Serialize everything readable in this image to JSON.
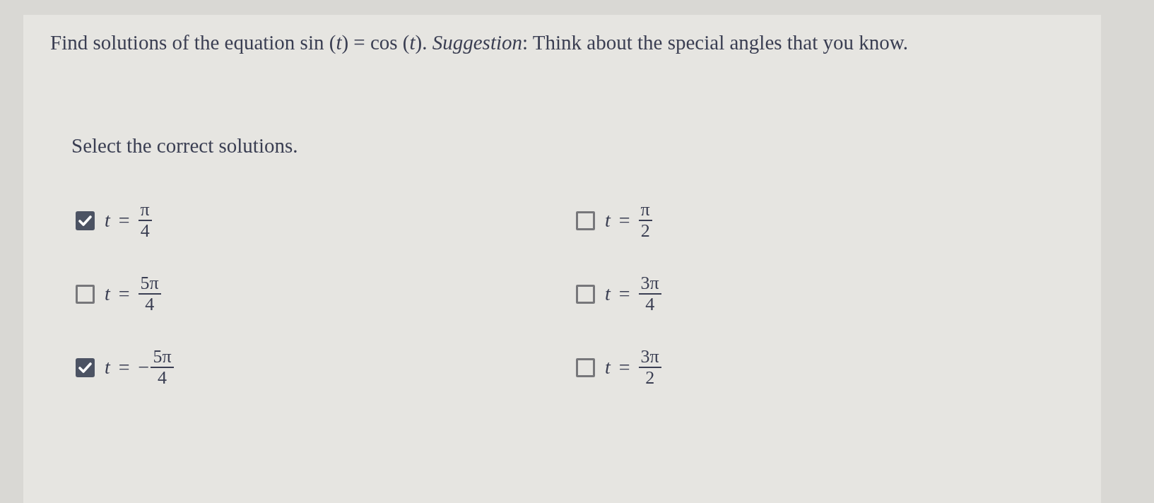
{
  "question": {
    "text": "Find solutions of the equation sin (*t*) = cos (*t*). *Suggestion*: Think about the special angles that you know."
  },
  "prompt": "Select the correct solutions.",
  "options": [
    {
      "variable": "t",
      "relation": "=",
      "numerator": "π",
      "denominator": "4",
      "checked": true
    },
    {
      "variable": "t",
      "relation": "=",
      "numerator": "π",
      "denominator": "2",
      "checked": false
    },
    {
      "variable": "t",
      "relation": "=",
      "numerator": "5π",
      "denominator": "4",
      "checked": false
    },
    {
      "variable": "t",
      "relation": "=",
      "numerator": "3π",
      "denominator": "4",
      "checked": false
    },
    {
      "variable": "t",
      "relation": "=",
      "sign": "−",
      "numerator": "5π",
      "denominator": "4",
      "checked": true
    },
    {
      "variable": "t",
      "relation": "=",
      "numerator": "3π",
      "denominator": "2",
      "checked": false
    }
  ]
}
